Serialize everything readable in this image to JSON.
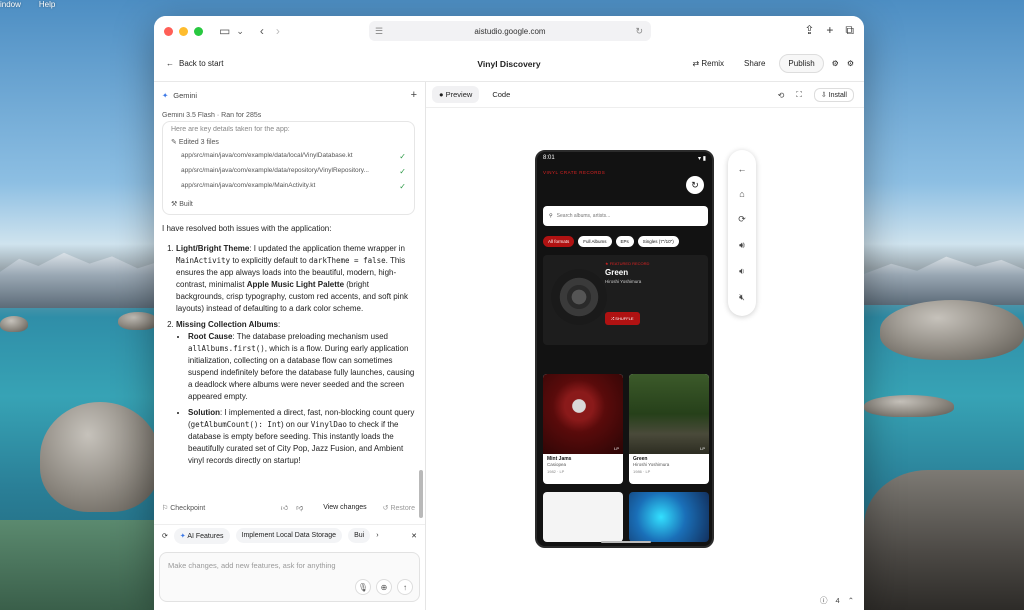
{
  "menubar": {
    "items": [
      "indow",
      "Help"
    ]
  },
  "browser": {
    "url": "aistudio.google.com"
  },
  "appbar": {
    "back_label": "Back to start",
    "title": "Vinyl Discovery",
    "remix_label": "Remix",
    "share_label": "Share",
    "publish_label": "Publish"
  },
  "chat": {
    "header_label": "Gemini",
    "model_meta": "Gemini 3.5 Flash",
    "ran_meta": "Ran for 285s",
    "cut_text": "Here are key details taken for the app:",
    "edited_label": "Edited 3 files",
    "files": [
      "app/src/main/java/com/example/data/local/VinylDatabase.kt",
      "app/src/main/java/com/example/data/repository/VinylRepository...",
      "app/src/main/java/com/example/MainActivity.kt"
    ],
    "built_label": "Built",
    "intro": "I have resolved both issues with the application:",
    "item1_title": "Light/Bright Theme",
    "item1_a": ": I updated the application theme wrapper in ",
    "item1_code1": "MainActivity",
    "item1_b": " to explicitly default to ",
    "item1_code2": "darkTheme = false",
    "item1_c": ". This ensures the app always loads into the beautiful, modern, high-contrast, minimalist ",
    "item1_bold": "Apple Music Light Palette",
    "item1_d": " (bright backgrounds, crisp typography, custom red accents, and soft pink layouts) instead of defaulting to a dark color scheme.",
    "item2_title": "Missing Collection Albums",
    "root_title": "Root Cause",
    "root_a": ": The database preloading mechanism used ",
    "root_code": "allAlbums.first()",
    "root_b": ", which is a flow. During early application initialization, collecting on a database flow can sometimes suspend indefinitely before the database fully launches, causing a deadlock where albums were never seeded and the screen appeared empty.",
    "sol_title": "Solution",
    "sol_a": ": I implemented a direct, fast, non-blocking count query (",
    "sol_code1": "getAlbumCount(): Int",
    "sol_b": ") on our ",
    "sol_code2": "VinylDao",
    "sol_c": " to check if the database is empty before seeding. This instantly loads the beautifully curated set of City Pop, Jazz Fusion, and Ambient vinyl records directly on startup!",
    "checkpoint_label": "Checkpoint",
    "view_changes_label": "View changes",
    "restore_label": "Restore",
    "chips": [
      "AI Features",
      "Implement Local Data Storage",
      "Bui"
    ],
    "input_placeholder": "Make changes, add new features, ask for anything"
  },
  "preview": {
    "tab_preview": "Preview",
    "tab_code": "Code",
    "install_label": "Install",
    "page_count": "4"
  },
  "phone": {
    "time": "8:01",
    "subtitle": "VINYL CRATE RECORDS",
    "search_placeholder": "Search albums, artists...",
    "filters": [
      "All formats",
      "Full Albums",
      "EPs",
      "Singles (7\"/10\")"
    ],
    "hero_featured": "★ FEATURED RECORD",
    "hero_title": "Green",
    "hero_artist": "Hiroshi Yoshimura",
    "shuffle_label": "⤮ SHUFFLE",
    "albums": [
      {
        "title": "Mint Jams",
        "artist": "Casiopea",
        "year": "1982 · LP",
        "tag": "LP"
      },
      {
        "title": "Green",
        "artist": "Hiroshi Yoshimura",
        "year": "1986 · LP",
        "tag": "LP"
      }
    ]
  },
  "colors": {
    "accent_red": "#b01212",
    "check_green": "#2e9a48"
  }
}
